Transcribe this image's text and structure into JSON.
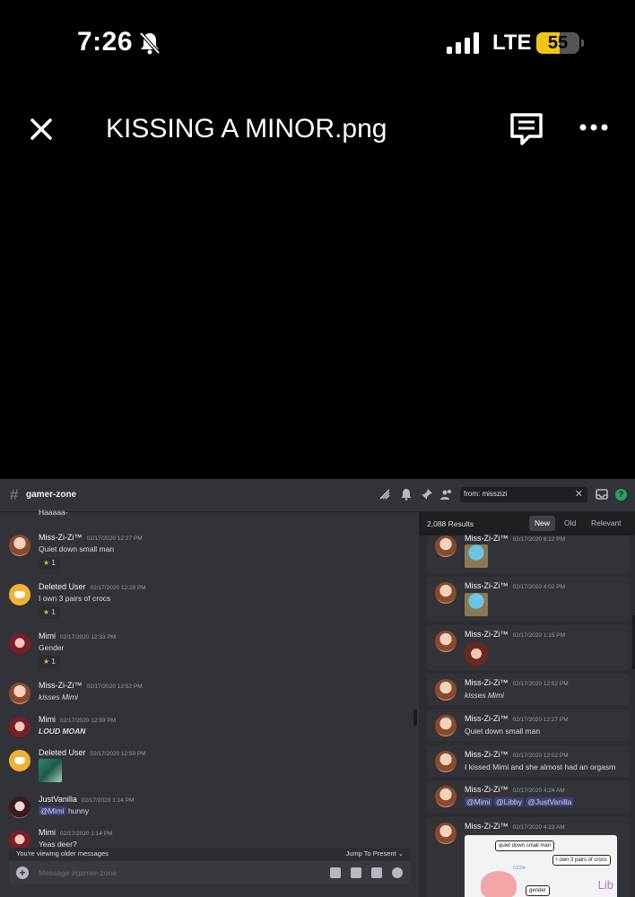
{
  "status_bar": {
    "time": "7:26",
    "network": "LTE",
    "battery": "55",
    "battery_level": 0.55
  },
  "top_bar": {
    "title": "KISSING A MINOR.png"
  },
  "discord": {
    "channel": "gamer-zone",
    "search_query": "from: misszizi",
    "chat": {
      "messages": [
        {
          "text": "Haaaaa-"
        },
        {
          "user": "Miss-Zi-Zi™",
          "time": "02/17/2020 12:27 PM",
          "text": "Quiet down small man",
          "reaction": "1"
        },
        {
          "user": "Deleted User",
          "time": "02/17/2020 12:28 PM",
          "text": "I own 3 pairs of crocs",
          "reaction": "1"
        },
        {
          "user": "Mimi",
          "time": "02/17/2020 12:33 PM",
          "text": "Gender",
          "reaction": "1"
        },
        {
          "user": "Miss-Zi-Zi™",
          "time": "02/17/2020 12:52 PM",
          "text": "kisses Mimi"
        },
        {
          "user": "Mimi",
          "time": "02/17/2020 12:59 PM",
          "text": "LOUD MOAN"
        },
        {
          "user": "Deleted User",
          "time": "02/17/2020 12:59 PM"
        },
        {
          "user": "JustVanilla",
          "time": "02/17/2020 1:14 PM",
          "mention": "@Mimi",
          "text": "hunny"
        },
        {
          "user": "Mimi",
          "time": "02/17/2020 1:14 PM",
          "text": "Yeas deer?"
        }
      ],
      "older_notice": "You're viewing older messages",
      "jump_label": "Jump To Present",
      "composer_placeholder": "Message #gamer-zone"
    },
    "results": {
      "count": "2,088 Results",
      "tabs": [
        "New",
        "Old",
        "Relevant"
      ],
      "active_tab": "New",
      "items": [
        {
          "user": "Miss-Zi-Zi™",
          "time": "02/17/2020 6:12 PM"
        },
        {
          "user": "Miss-Zi-Zi™",
          "time": "02/17/2020 4:02 PM"
        },
        {
          "user": "Miss-Zi-Zi™",
          "time": "02/17/2020 1:15 PM"
        },
        {
          "user": "Miss-Zi-Zi™",
          "time": "02/17/2020 12:52 PM",
          "text": "kisses Mimi"
        },
        {
          "user": "Miss-Zi-Zi™",
          "time": "02/17/2020 12:27 PM",
          "text": "Quiet down small man"
        },
        {
          "user": "Miss-Zi-Zi™",
          "time": "02/17/2020 12:02 PM",
          "text": "I kissed Mimi and she almost had an orgasm"
        },
        {
          "user": "Miss-Zi-Zi™",
          "time": "02/17/2020 4:24 AM",
          "mentions": [
            "@Mimi",
            "@Libby",
            "@JustVanilla"
          ]
        },
        {
          "user": "Miss-Zi-Zi™",
          "time": "02/17/2020 4:23 AM",
          "image_text": {
            "bubble1": "quiet down small man",
            "bubble2": "I own 3 pairs of crocs",
            "bubble3": "gender",
            "corner": "Lib",
            "small": "ozzie"
          }
        }
      ]
    }
  },
  "colors": {
    "accent_yellow": "#f2c318",
    "star": "#f0b232",
    "help_green": "#23a55a",
    "mention_bg": "#3c4270"
  }
}
